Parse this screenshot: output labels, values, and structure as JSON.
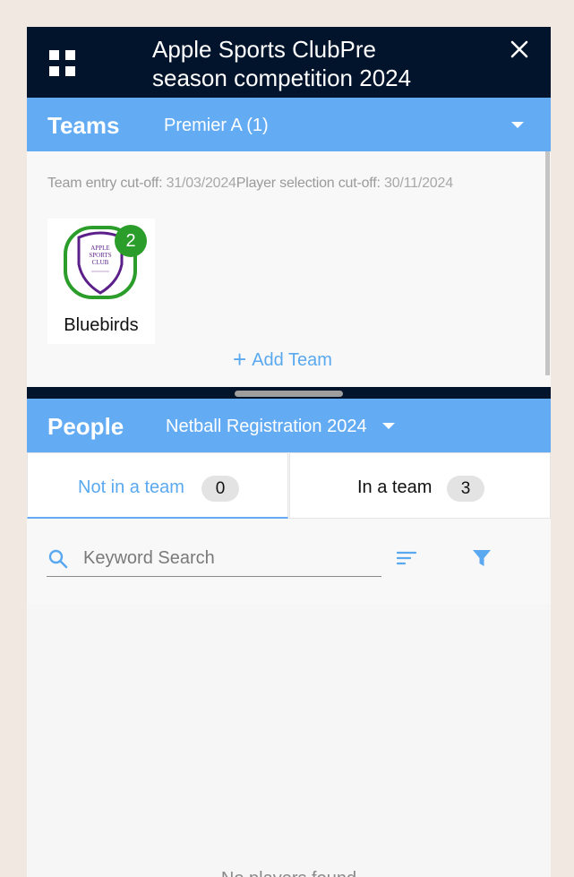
{
  "header": {
    "title": "Apple Sports ClubPre season competition 2024"
  },
  "teams": {
    "section_title": "Teams",
    "selected_grade": "Premier A (1)",
    "cutoff": {
      "team_label": "Team entry cut-off:",
      "team_value": "31/03/2024",
      "player_label": "Player selection cut-off:",
      "player_value": "30/11/2024"
    },
    "cards": [
      {
        "name": "Bluebirds",
        "badge": "2",
        "logo_text": [
          "APPLE",
          "SPORTS",
          "CLUB"
        ]
      }
    ],
    "add_team_label": "Add Team"
  },
  "people": {
    "section_title": "People",
    "selected_registration": "Netball Registration 2024",
    "tabs": [
      {
        "label": "Not in a team",
        "count": "0"
      },
      {
        "label": "In a team",
        "count": "3"
      }
    ],
    "search": {
      "placeholder": "Keyword Search"
    },
    "empty_text": "No players found"
  },
  "colors": {
    "navy": "#02142c",
    "accent_blue": "#63acf4",
    "badge_green": "#2a9d2a",
    "shield_purple": "#5b1f8a"
  },
  "icons": [
    "grid-icon",
    "close-icon",
    "chevron-down-icon",
    "plus-icon",
    "search-icon",
    "sort-icon",
    "filter-icon"
  ]
}
